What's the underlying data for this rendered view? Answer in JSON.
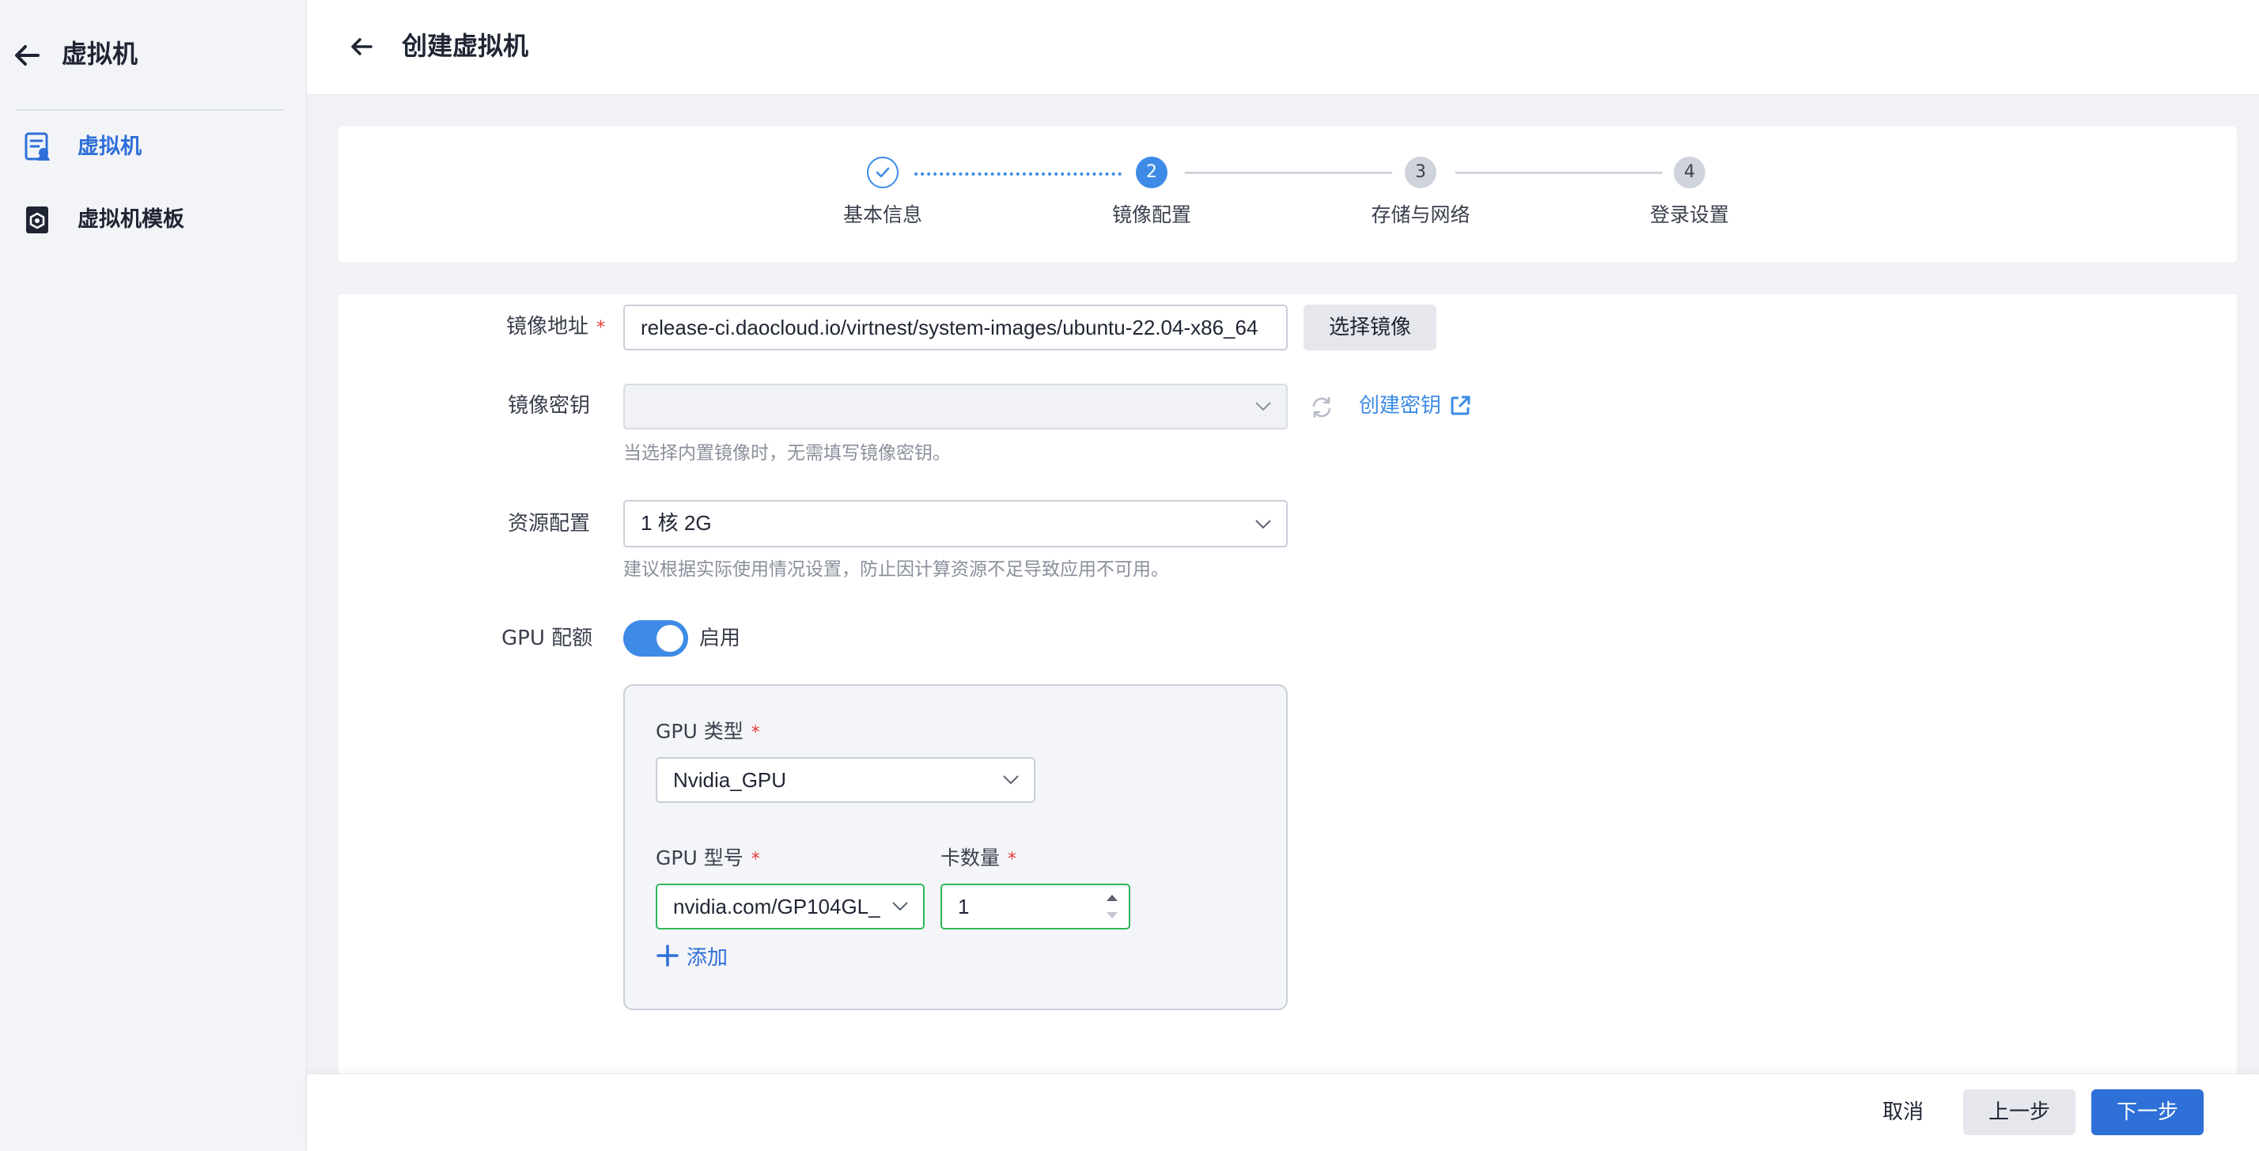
{
  "sidebar": {
    "title": "虚拟机",
    "items": [
      {
        "label": "虚拟机",
        "icon": "vm-icon",
        "active": true
      },
      {
        "label": "虚拟机模板",
        "icon": "vm-template-icon",
        "active": false
      }
    ]
  },
  "header": {
    "title": "创建虚拟机"
  },
  "steps": [
    {
      "number": "",
      "label": "基本信息",
      "state": "done"
    },
    {
      "number": "2",
      "label": "镜像配置",
      "state": "current"
    },
    {
      "number": "3",
      "label": "存储与网络",
      "state": "todo"
    },
    {
      "number": "4",
      "label": "登录设置",
      "state": "todo"
    }
  ],
  "form": {
    "image_address": {
      "label": "镜像地址",
      "required_mark": "*",
      "value": "release-ci.daocloud.io/virtnest/system-images/ubuntu-22.04-x86_64",
      "select_button": "选择镜像"
    },
    "image_secret": {
      "label": "镜像密钥",
      "value": "",
      "create_link": "创建密钥",
      "hint": "当选择内置镜像时，无需填写镜像密钥。"
    },
    "resource": {
      "label": "资源配置",
      "value": "1 核 2G",
      "hint": "建议根据实际使用情况设置，防止因计算资源不足导致应用不可用。"
    },
    "gpu": {
      "label": "GPU 配额",
      "toggle_on": true,
      "toggle_text": "启用",
      "type_label": "GPU 类型",
      "type_value": "Nvidia_GPU",
      "model_label": "GPU 型号",
      "model_value": "nvidia.com/GP104GL_",
      "count_label": "卡数量",
      "count_value": "1",
      "add_label": "添加",
      "required_mark": "*"
    }
  },
  "footer": {
    "cancel": "取消",
    "prev": "上一步",
    "next": "下一步"
  },
  "colors": {
    "accent": "#3d8be6",
    "primary_button": "#2e6fd8",
    "required": "#e23b3b",
    "valid_border": "#2fb65a"
  }
}
